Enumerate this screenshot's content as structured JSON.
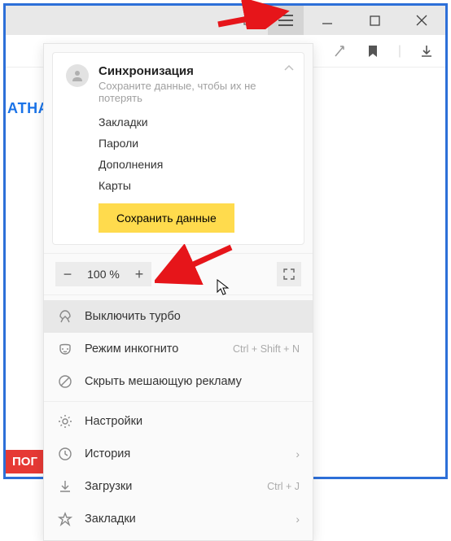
{
  "sync": {
    "title": "Синхронизация",
    "subtitle": "Сохраните данные, чтобы их не потерять",
    "links": [
      "Закладки",
      "Пароли",
      "Дополнения",
      "Карты"
    ],
    "save_button": "Сохранить данные"
  },
  "zoom": {
    "minus": "−",
    "pct": "100 %",
    "plus": "+"
  },
  "menu": {
    "turbo": "Выключить турбо",
    "incognito": {
      "label": "Режим инкогнито",
      "shortcut": "Ctrl + Shift + N"
    },
    "hide_ads": "Скрыть мешающую рекламу",
    "settings": "Настройки",
    "history": "История",
    "downloads": {
      "label": "Загрузки",
      "shortcut": "Ctrl + J"
    },
    "bookmarks": "Закладки"
  },
  "bg": {
    "left_text": "АТНА",
    "red_badge": "ПОГ"
  }
}
